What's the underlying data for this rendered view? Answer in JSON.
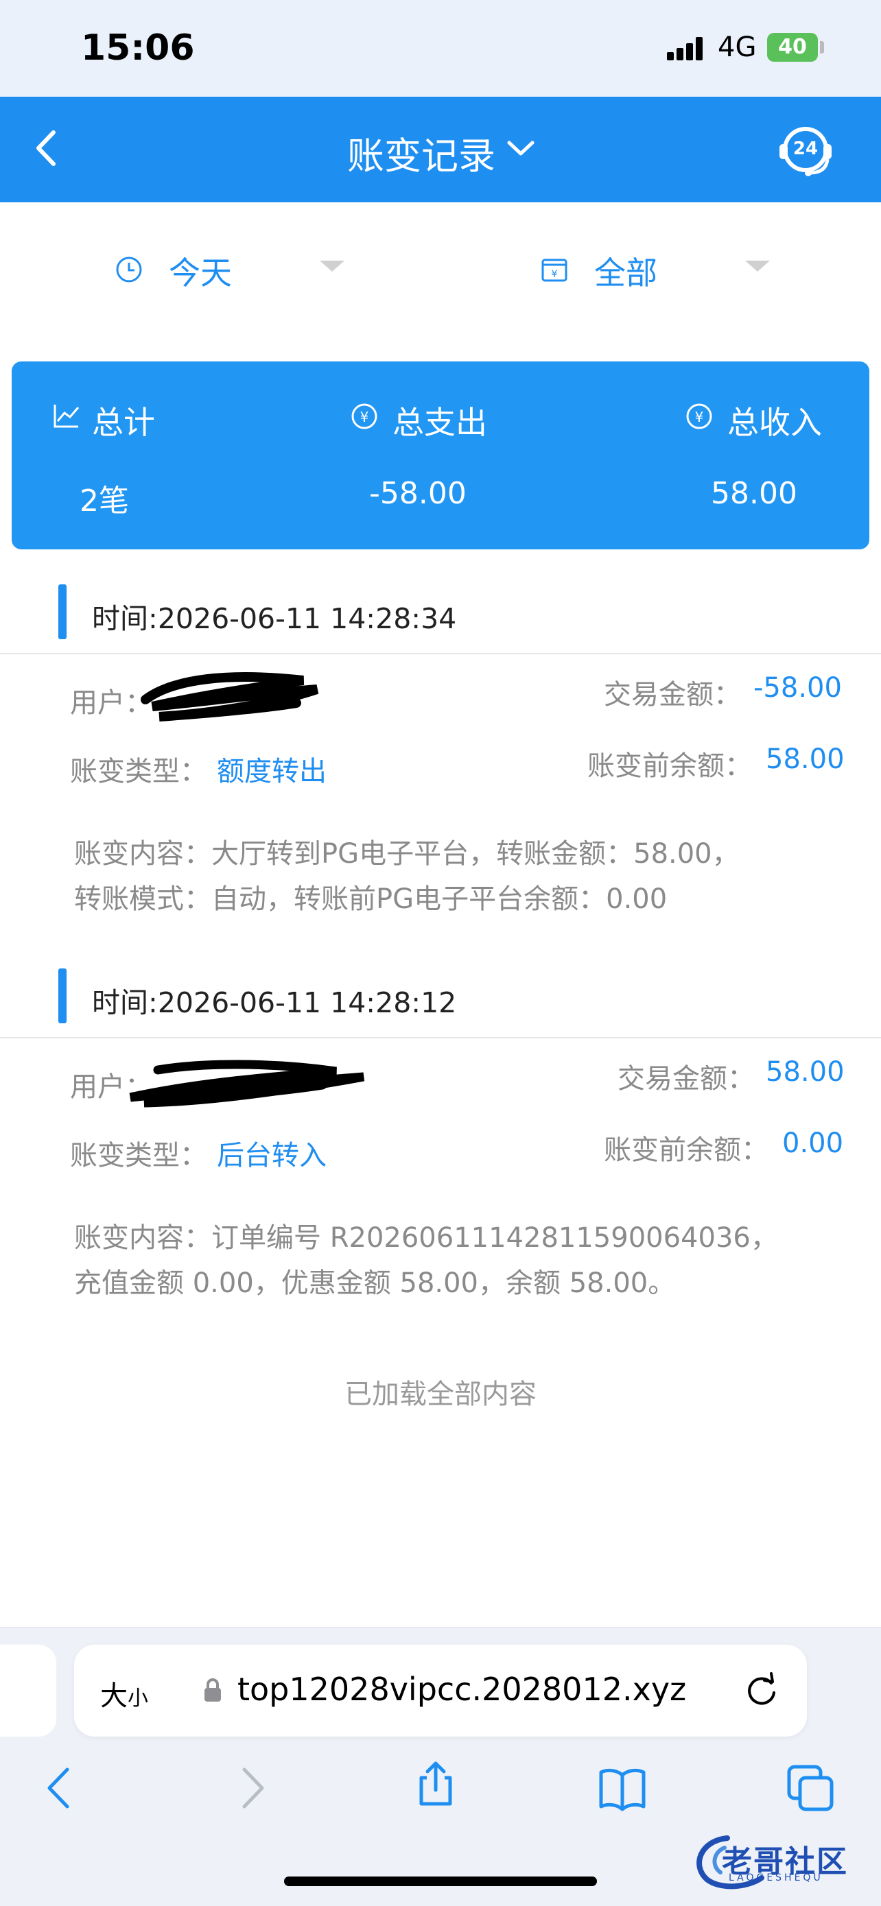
{
  "status_bar": {
    "time": "15:06",
    "network": "4G",
    "battery": "40"
  },
  "header": {
    "title": "账变记录",
    "back_icon": "chevron-left-icon",
    "title_dropdown_icon": "chevron-down-icon",
    "support_icon": "headset-24-icon",
    "support_badge": "24"
  },
  "filters": {
    "date": {
      "label": "今天",
      "icon": "clock-icon"
    },
    "type": {
      "label": "全部",
      "icon": "calendar-yen-icon"
    }
  },
  "summary": {
    "total_label": "总计",
    "total_value": "2笔",
    "expense_label": "总支出",
    "expense_value": "-58.00",
    "income_label": "总收入",
    "income_value": "58.00"
  },
  "records": [
    {
      "time": "时间:2026-06-11 14:28:34",
      "user_label": "用户：",
      "amount_label": "交易金额：",
      "amount": "-58.00",
      "type_label": "账变类型：",
      "type": "额度转出",
      "balance_label": "账变前余额：",
      "balance": "58.00",
      "content_line1": "账变内容：大厅转到PG电子平台，转账金额：58.00，",
      "content_line2": "转账模式：自动，转账前PG电子平台余额：0.00"
    },
    {
      "time": "时间:2026-06-11 14:28:12",
      "user_label": "用户：",
      "amount_label": "交易金额：",
      "amount": "58.00",
      "type_label": "账变类型：",
      "type": "后台转入",
      "balance_label": "账变前余额：",
      "balance": "0.00",
      "content_line1": "账变内容：订单编号 R202606111428115900640​36，",
      "content_line2": "充值金额 0.00，优惠金额 58.00，余额 58.00。"
    }
  ],
  "footer_text": "已加载全部内容",
  "browser": {
    "text_size_label": "大",
    "text_size_small": "小",
    "url": "top12028vipcc.2028012.xyz"
  },
  "watermark": {
    "text": "老哥社区",
    "sub": "LAOGESHEQU"
  },
  "colors": {
    "primary": "#1f8ef1",
    "summary_bg": "#2196f3",
    "muted": "#8a8a8a"
  }
}
